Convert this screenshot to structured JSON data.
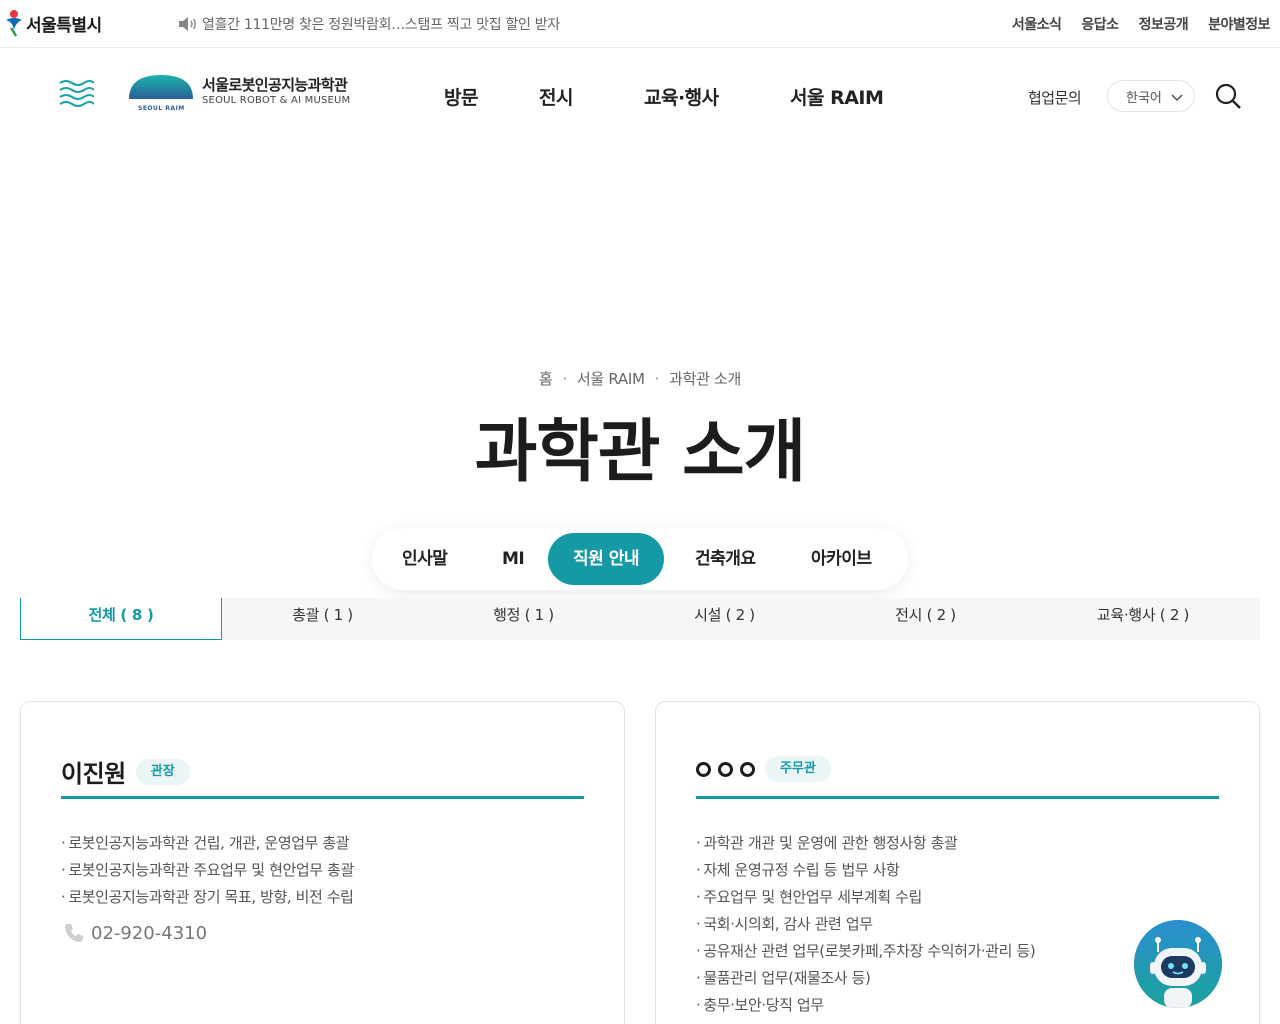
{
  "top_bar": {
    "city_logo_text": "서울특별시",
    "notice_text": "열흘간 111만명 찾은 정원박람회…스탬프 찍고 맛집 할인 받자",
    "links": [
      "서울소식",
      "응답소",
      "정보공개",
      "분야별정보"
    ]
  },
  "header": {
    "brand_ko": "서울로봇인공지능과학관",
    "brand_en": "SEOUL ROBOT & AI MUSEUM",
    "brand_emblem_text": "SEOUL RAIM",
    "nav": [
      "방문",
      "전시",
      "교육·행사",
      "서울 RAIM"
    ],
    "collab_label": "협업문의",
    "language": "한국어"
  },
  "breadcrumb": [
    "홈",
    "서울 RAIM",
    "과학관 소개"
  ],
  "page_title": "과학관 소개",
  "sub_tabs": {
    "items": [
      "인사말",
      "MI",
      "직원 안내",
      "건축개요",
      "아카이브"
    ],
    "active": "직원 안내"
  },
  "categories": [
    {
      "label": "전체 ( 8 )",
      "active": true
    },
    {
      "label": "총괄 ( 1 )",
      "active": false
    },
    {
      "label": "행정 ( 1 )",
      "active": false
    },
    {
      "label": "시설 ( 2 )",
      "active": false
    },
    {
      "label": "전시 ( 2 )",
      "active": false
    },
    {
      "label": "교육·행사 ( 2 )",
      "active": false
    }
  ],
  "staff": [
    {
      "name": "이진원",
      "role": "관장",
      "duties": [
        "로봇인공지능과학관 건립, 개관, 운영업무 총괄",
        "로봇인공지능과학관 주요업무 및 현안업무 총괄",
        "로봇인공지능과학관 장기 목표, 방향, 비전 수립"
      ],
      "phone": "02-920-4310"
    },
    {
      "name": "○○○",
      "role": "주무관",
      "duties": [
        "과학관 개관 및 운영에 관한 행정사항 총괄",
        "자체 운영규정 수립 등 법무 사항",
        "주요업무 및 현안업무 세부계획 수립",
        "국회·시의회, 감사 관련 업무",
        "공유재산 관련 업무(로봇카페,주차장 수익허가·관리 등)",
        "물품관리 업무(재물조사 등)",
        "충무·보안·당직 업무"
      ]
    }
  ],
  "colors": {
    "accent": "#1599a5",
    "accent_light": "#eaf5f6",
    "chatbot_bg": "#1d6aa8"
  }
}
